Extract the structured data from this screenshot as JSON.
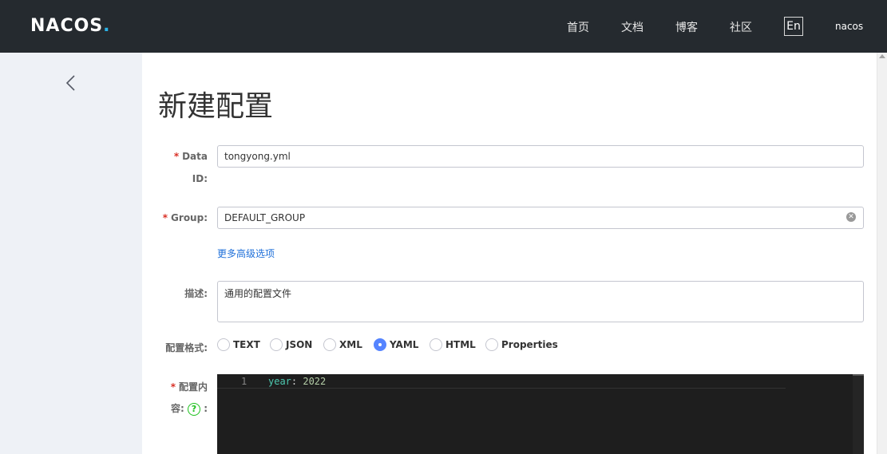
{
  "header": {
    "logo": "NACOS",
    "logo_dot": ".",
    "nav": [
      {
        "label": "首页"
      },
      {
        "label": "文档"
      },
      {
        "label": "博客"
      },
      {
        "label": "社区"
      }
    ],
    "lang": "En",
    "user": "nacos"
  },
  "page": {
    "title": "新建配置"
  },
  "form": {
    "data_id": {
      "label_line1": "Data",
      "label_line2": "ID:",
      "value": "tongyong.yml"
    },
    "group": {
      "label": "Group:",
      "value": "DEFAULT_GROUP"
    },
    "more_options": "更多高级选项",
    "description": {
      "label": "描述:",
      "value": "通用的配置文件"
    },
    "format": {
      "label": "配置格式:",
      "options": [
        {
          "label": "TEXT",
          "checked": false
        },
        {
          "label": "JSON",
          "checked": false
        },
        {
          "label": "XML",
          "checked": false
        },
        {
          "label": "YAML",
          "checked": true
        },
        {
          "label": "HTML",
          "checked": false
        },
        {
          "label": "Properties",
          "checked": false
        }
      ]
    },
    "content": {
      "label_line1": "配置内",
      "label_line2": "容:",
      "label_suffix": ":",
      "lines": [
        {
          "num": "1",
          "key": "year",
          "sep": ": ",
          "val": "2022"
        }
      ]
    },
    "required_mark": "*"
  },
  "colors": {
    "header_bg": "#252a2f",
    "sidebar_bg": "#eef1f6",
    "accent": "#5584ff",
    "required": "#d93026",
    "link": "#1e6fd9",
    "help": "#1dc11d"
  },
  "icons": {
    "back": "chevron-left-icon",
    "clear": "clear-circle-icon",
    "help": "question-circle-icon",
    "help_glyph": "?"
  }
}
